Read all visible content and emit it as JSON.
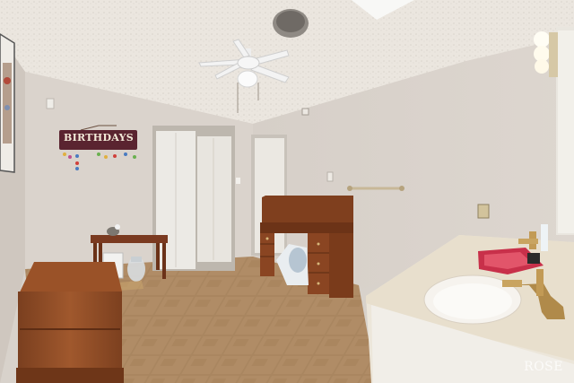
{
  "scene": {
    "description_kind": "interior-photo",
    "sign_text": "BIRTHDAYS",
    "watermark_text": "ROSE"
  },
  "colors": {
    "ceiling": "#ece7e0",
    "wall_left": "#d9d2cb",
    "wall_right": "#d4cdc6",
    "floor_tile": "#a8835c",
    "wood": "#8a4a26",
    "closet_door": "#ece9e4",
    "counter": "#e9e1d2",
    "caddy": "#c8304a",
    "faucet": "#b08a4a"
  }
}
